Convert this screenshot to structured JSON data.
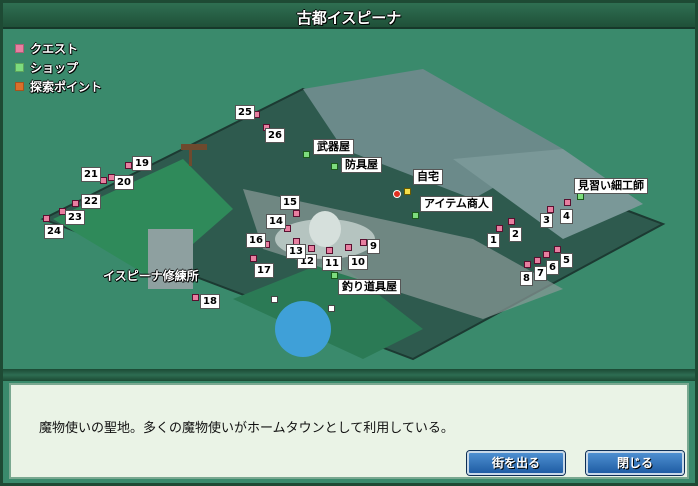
{
  "window": {
    "title": "古都イスピーナ"
  },
  "legend": [
    {
      "label": "クエスト",
      "color": "#e87fa0"
    },
    {
      "label": "ショップ",
      "color": "#7ddc7d"
    },
    {
      "label": "探索ポイント",
      "color": "#d9702a"
    }
  ],
  "places": {
    "weapon_shop": "武器屋",
    "armor_shop": "防具屋",
    "home": "自宅",
    "item_merchant": "アイテム商人",
    "apprentice": "見習い細工師",
    "fishing_shop": "釣り道具屋",
    "training_hall": "イスピーナ修練所"
  },
  "quest_numbers": [
    "1",
    "2",
    "3",
    "4",
    "5",
    "6",
    "7",
    "8",
    "9",
    "10",
    "11",
    "12",
    "13",
    "14",
    "15",
    "16",
    "17",
    "18",
    "19",
    "20",
    "21",
    "22",
    "23",
    "24",
    "25",
    "26"
  ],
  "message": {
    "text": "魔物使いの聖地。多くの魔物使いがホームタウンとして利用している。"
  },
  "buttons": {
    "leave_town": "街を出る",
    "close": "閉じる"
  }
}
